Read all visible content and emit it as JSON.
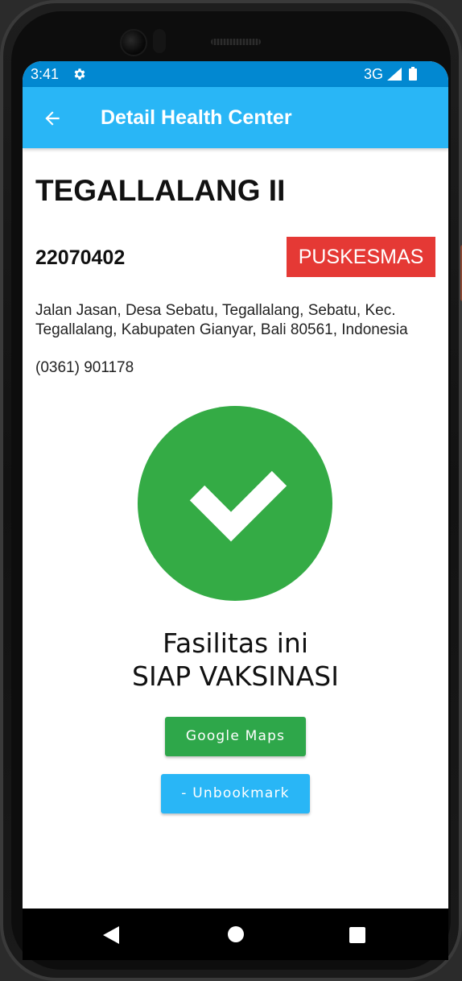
{
  "status_bar": {
    "time": "3:41",
    "network": "3G",
    "gear_icon": "settings-gear-icon",
    "signal_icon": "signal-icon",
    "battery_icon": "battery-icon"
  },
  "app_bar": {
    "title": "Detail Health Center",
    "back_icon": "arrow-back-icon",
    "color": "#29b6f6"
  },
  "center": {
    "name": "TEGALLALANG II",
    "code": "22070402",
    "type": "PUSKESMAS",
    "type_color": "#e53935",
    "address": "Jalan Jasan, Desa Sebatu, Tegallalang, Sebatu, Kec. Tegallalang, Kabupaten Gianyar, Bali 80561, Indonesia",
    "phone": "(0361) 901178"
  },
  "vaccination_status": {
    "icon": "check-circle-icon",
    "color": "#34ab45",
    "line1": "Fasilitas ini",
    "line2": "SIAP VAKSINASI"
  },
  "actions": {
    "maps_label": "Google Maps",
    "maps_color": "#2ea74a",
    "unbookmark_label": "- Unbookmark",
    "unbookmark_color": "#29b6f6"
  },
  "nav_bar": {
    "back_icon": "nav-back-icon",
    "home_icon": "nav-home-icon",
    "recents_icon": "nav-recents-icon"
  }
}
